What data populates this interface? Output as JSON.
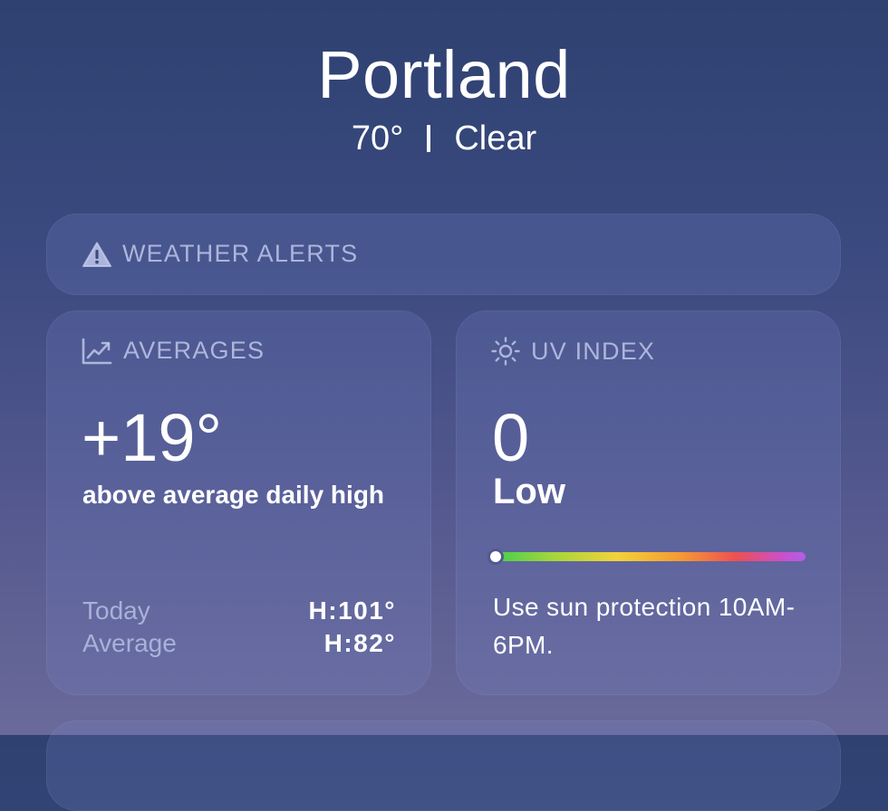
{
  "location": {
    "city": "Portland",
    "temperature": "70°",
    "condition": "Clear"
  },
  "alerts": {
    "title": "WEATHER ALERTS",
    "icon": "warning-triangle-icon"
  },
  "averages": {
    "title": "AVERAGES",
    "icon": "chart-trend-icon",
    "value": "+19°",
    "description": "above average daily high",
    "rows": [
      {
        "label": "Today",
        "value": "H:101°"
      },
      {
        "label": "Average",
        "value": "H:82°"
      }
    ]
  },
  "uv_index": {
    "title": "UV INDEX",
    "icon": "sun-icon",
    "value": "0",
    "level": "Low",
    "level_fraction": 0,
    "note": "Use sun protection 10AM-6PM."
  },
  "colors": {
    "background_top": "#2e4170",
    "background_bottom": "#6a6a9a",
    "uv_gradient": [
      "#3fcf4e",
      "#f3d23a",
      "#f59a32",
      "#ee4f52",
      "#b05fe8"
    ]
  }
}
